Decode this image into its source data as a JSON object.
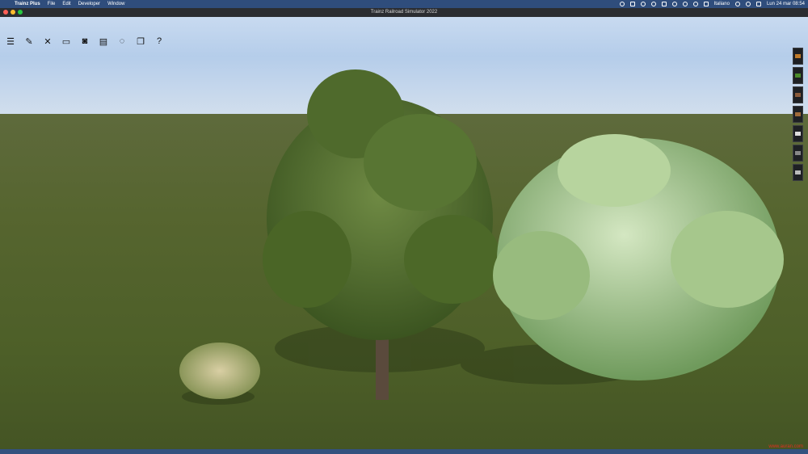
{
  "menubar": {
    "apple_glyph": "",
    "items": [
      "Trainz Plus",
      "File",
      "Edit",
      "Developer",
      "Window"
    ],
    "language": "Italiano",
    "clock": "Lun 24 mar  08:54"
  },
  "window": {
    "title": "Trainz Railroad Simulator 2022"
  },
  "toolbar": {
    "icons": [
      "menu-icon",
      "edit-icon",
      "tools-icon",
      "monitor-icon",
      "camera-icon",
      "layers-icon",
      "chat-icon",
      "windows-icon",
      "help-icon"
    ],
    "glyphs": [
      "☰",
      "✎",
      "✕",
      "▭",
      "◙",
      "▤",
      "◌",
      "❐",
      "?"
    ]
  },
  "right_panel": {
    "icons": [
      "tool-orange-icon",
      "tool-green-icon",
      "tool-brown-icon",
      "tool-tan-icon",
      "tool-white-icon",
      "tool-grey-icon",
      "tool-plus-icon"
    ],
    "colors": [
      "#c07a2a",
      "#4a8a2a",
      "#8a5a3a",
      "#a06a3a",
      "#dddddd",
      "#888888",
      "#bbbbbb"
    ]
  },
  "colors": {
    "menubar": "#2f4d7c",
    "titlebar": "#2b2d31",
    "ground": "#56652f",
    "tree_dark": "#3f5a22",
    "tree_light": "#9ebf84",
    "trunk": "#5a4a3c"
  },
  "watermark": "www.auran.com"
}
